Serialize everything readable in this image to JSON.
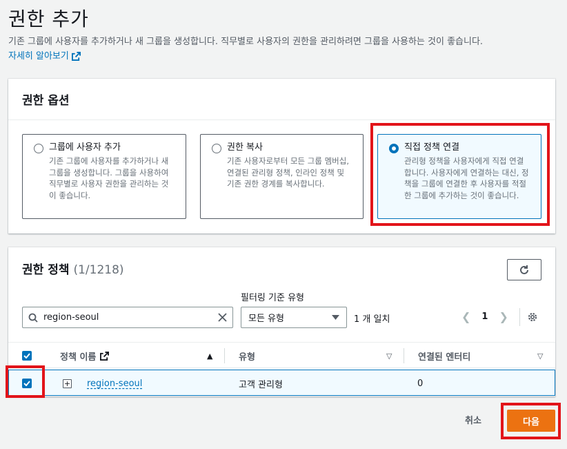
{
  "page": {
    "title": "권한 추가",
    "description": "기존 그룹에 사용자를 추가하거나 새 그룹을 생성합니다. 직무별로 사용자의 권한을 관리하려면 그룹을 사용하는 것이 좋습니다.",
    "learn_more": "자세히 알아보기"
  },
  "options_panel": {
    "header": "권한 옵션",
    "options": [
      {
        "title": "그룹에 사용자 추가",
        "desc": "기존 그룹에 사용자를 추가하거나 새 그룹을 생성합니다. 그룹을 사용하여 직무별로 사용자 권한을 관리하는 것이 좋습니다.",
        "selected": false
      },
      {
        "title": "권한 복사",
        "desc": "기존 사용자로부터 모든 그룹 멤버십, 연결된 관리형 정책, 인라인 정책 및 기존 권한 경계를 복사합니다.",
        "selected": false
      },
      {
        "title": "직접 정책 연결",
        "desc": "관리형 정책을 사용자에게 직접 연결합니다. 사용자에게 연결하는 대신, 정책을 그룹에 연결한 후 사용자를 적절한 그룹에 추가하는 것이 좋습니다.",
        "selected": true
      }
    ]
  },
  "policies_panel": {
    "title": "권한 정책",
    "count": "(1/1218)",
    "filter_label": "필터링 기준 유형",
    "search_value": "region-seoul",
    "filter_value": "모든 유형",
    "match_text": "1 개 일치",
    "page_number": "1",
    "columns": {
      "name": "정책 이름",
      "type": "유형",
      "entities": "연결된 엔터티"
    },
    "rows": [
      {
        "name": "region-seoul",
        "type": "고객 관리형",
        "entities": "0",
        "checked": true
      }
    ]
  },
  "footer": {
    "cancel": "취소",
    "next": "다음"
  },
  "colors": {
    "accent": "#0073bb",
    "primary_button": "#ec7211",
    "highlight": "#e2141a"
  }
}
